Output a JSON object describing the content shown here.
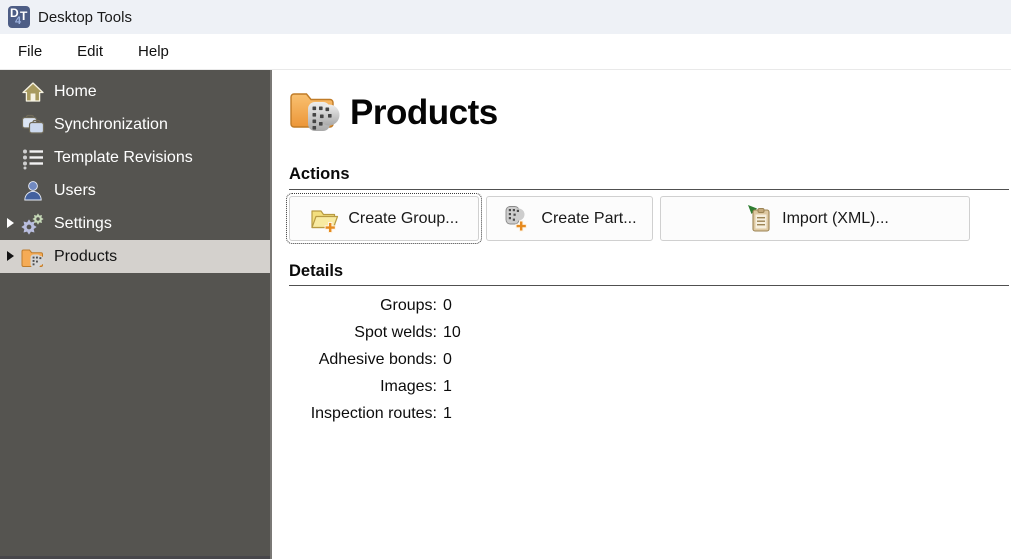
{
  "titlebar": {
    "title": "Desktop Tools",
    "icon": {
      "d": "D",
      "t": "T",
      "four": "4"
    }
  },
  "menu": {
    "items": [
      {
        "label": "File"
      },
      {
        "label": "Edit"
      },
      {
        "label": "Help"
      }
    ]
  },
  "sidebar": {
    "items": [
      {
        "label": "Home",
        "icon": "home-icon",
        "expandable": false,
        "selected": false
      },
      {
        "label": "Synchronization",
        "icon": "sync-icon",
        "expandable": false,
        "selected": false
      },
      {
        "label": "Template Revisions",
        "icon": "template-revisions-icon",
        "expandable": false,
        "selected": false
      },
      {
        "label": "Users",
        "icon": "users-icon",
        "expandable": false,
        "selected": false
      },
      {
        "label": "Settings",
        "icon": "settings-gears-icon",
        "expandable": true,
        "selected": false
      },
      {
        "label": "Products",
        "icon": "products-folder-icon",
        "expandable": true,
        "selected": true
      }
    ]
  },
  "main": {
    "title": "Products",
    "title_icon": "products-folder-large-icon",
    "actions": {
      "heading": "Actions",
      "buttons": [
        {
          "label": "Create Group...",
          "icon": "create-group-icon",
          "focused": true
        },
        {
          "label": "Create Part...",
          "icon": "create-part-icon",
          "focused": false
        },
        {
          "label": "Import (XML)...",
          "icon": "import-xml-icon",
          "focused": false
        }
      ]
    },
    "details": {
      "heading": "Details",
      "rows": [
        {
          "label": "Groups:",
          "value": "0"
        },
        {
          "label": "Spot welds:",
          "value": "10"
        },
        {
          "label": "Adhesive bonds:",
          "value": "0"
        },
        {
          "label": "Images:",
          "value": "1"
        },
        {
          "label": "Inspection routes:",
          "value": "1"
        }
      ]
    }
  },
  "colors": {
    "sidebar_bg": "#555450",
    "sidebar_selected_bg": "#d4d1cd",
    "titlebar_bg": "#eef1f6",
    "folder_orange": "#f0a04a",
    "plus_orange": "#e68a1f",
    "import_arrow_green": "#2e7d32",
    "app_icon_blue": "#4d5d85",
    "gear_lavender": "#b9bedf",
    "gear_green": "#c5d8b6"
  }
}
